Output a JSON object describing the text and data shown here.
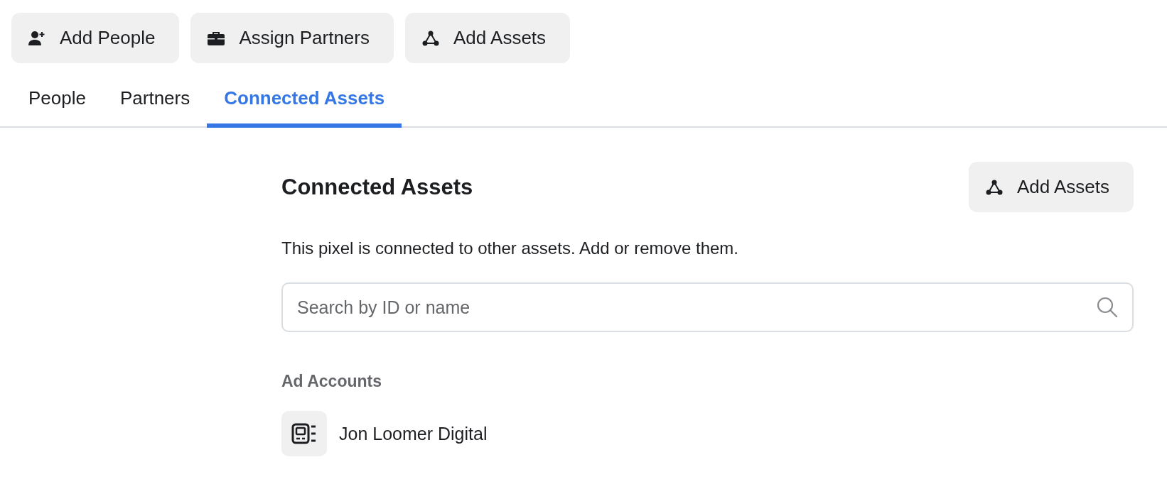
{
  "action_buttons": [
    {
      "label": "Add People",
      "kind": "person-add"
    },
    {
      "label": "Assign Partners",
      "kind": "briefcase"
    },
    {
      "label": "Add Assets",
      "kind": "network"
    }
  ],
  "tabs": [
    {
      "label": "People",
      "selected": false
    },
    {
      "label": "Partners",
      "selected": false
    },
    {
      "label": "Connected Assets",
      "selected": true
    }
  ],
  "section": {
    "title": "Connected Assets",
    "add_button": {
      "label": "Add Assets",
      "kind": "network"
    },
    "description": "This pixel is connected to other assets. Add or remove them.",
    "search": {
      "placeholder": "Search by ID or name"
    },
    "groups": [
      {
        "title": "Ad Accounts",
        "items": [
          {
            "name": "Jon Loomer Digital",
            "kind": "ad-account"
          }
        ]
      }
    ]
  }
}
